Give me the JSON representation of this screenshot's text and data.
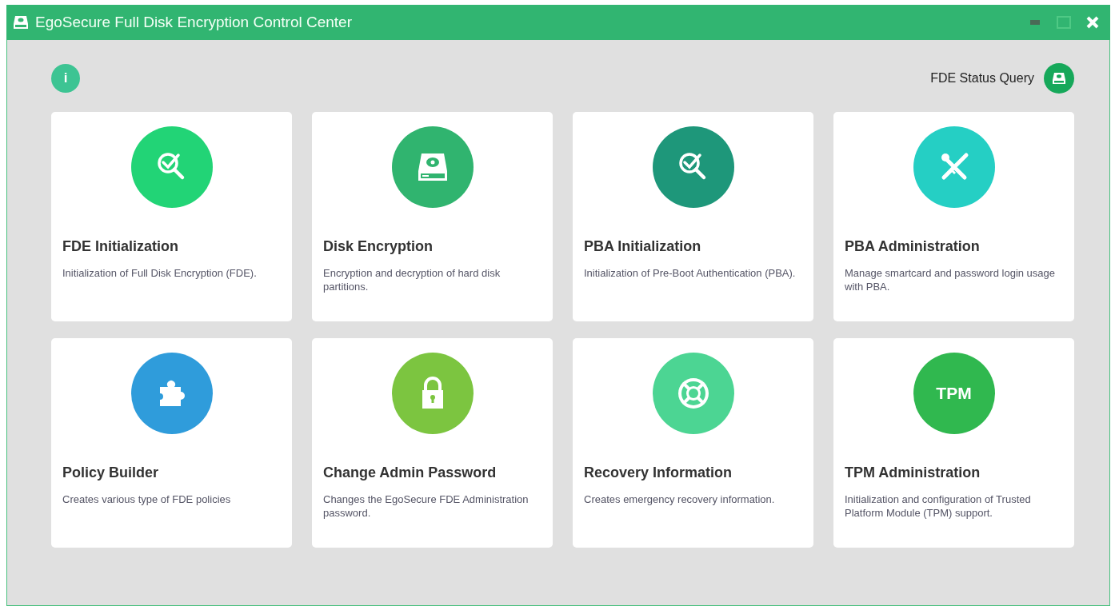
{
  "window": {
    "title": "EgoSecure Full Disk Encryption Control Center",
    "maximize_disabled": true
  },
  "info_button": {
    "label": "i"
  },
  "status_query": {
    "label": "FDE Status Query"
  },
  "tiles": [
    {
      "kind": "check-search",
      "color": "#22d476",
      "title": "FDE Initialization",
      "description": "Initialization of Full Disk Encryption (FDE)."
    },
    {
      "kind": "disk",
      "color": "#30b46f",
      "title": "Disk Encryption",
      "description": "Encryption and decryption of hard disk partitions."
    },
    {
      "kind": "check-search",
      "color": "#1e977a",
      "title": "PBA Initialization",
      "description": "Initialization of Pre-Boot Authentication (PBA)."
    },
    {
      "kind": "tools",
      "color": "#25cfc4",
      "title": "PBA Administration",
      "description": "Manage smartcard and password login usage with PBA."
    },
    {
      "kind": "puzzle",
      "color": "#2f9cdb",
      "title": "Policy Builder",
      "description": "Creates various type of FDE policies"
    },
    {
      "kind": "lock",
      "color": "#7cc540",
      "title": "Change Admin Password",
      "description": "Changes the EgoSecure FDE Administration password."
    },
    {
      "kind": "lifebuoy",
      "color": "#4cd593",
      "title": "Recovery Information",
      "description": "Creates emergency recovery information."
    },
    {
      "kind": "text",
      "color": "#30b84f",
      "icon_text": "TPM",
      "title": "TPM Administration",
      "description": "Initialization and configuration of Trusted Platform Module (TPM) support."
    }
  ]
}
